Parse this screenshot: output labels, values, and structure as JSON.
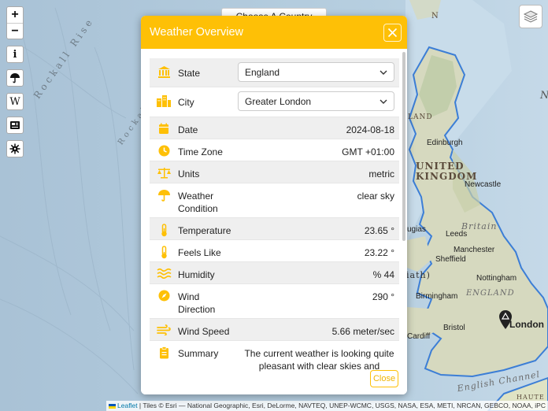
{
  "map": {
    "features": [
      "Rockall Rise",
      "Rockall"
    ],
    "regions": [
      "UNITED",
      "KINGDOM",
      "Britain",
      "ENGLAND",
      "English Channel",
      "HAUTE",
      "(IRELAND)"
    ],
    "partial_labels": [
      "LAND",
      "ugias",
      "iath)",
      "N",
      "N"
    ],
    "cities": [
      "Edinburgh",
      "Newcastle",
      "Leeds",
      "Manchester",
      "Sheffield",
      "Nottingham",
      "Birmingham",
      "Bristol",
      "Cardiff",
      "London"
    ],
    "country_select": "Choose A Country",
    "attribution": "Leaflet | Tiles © Esri — National Geographic, Esri, DeLorme, NAVTEQ, UNEP-WCMC, USGS, NASA, ESA, METI, NRCAN, GEBCO, NOAA, iPC",
    "attribution_link": "Leaflet",
    "attribution_rest": " | Tiles © Esri — National Geographic, Esri, DeLorme, NAVTEQ, UNEP-WCMC, USGS, NASA, ESA, METI, NRCAN, GEBCO, NOAA, iPC"
  },
  "controls": {
    "zoom_in": "+",
    "zoom_out": "−",
    "info": "i",
    "wiki": "W"
  },
  "modal": {
    "title": "Weather Overview",
    "close_button": "Close",
    "accent_color": "#fec006",
    "rows": [
      {
        "icon": "landmark-icon",
        "label": "State",
        "value": "England",
        "type": "select"
      },
      {
        "icon": "city-icon",
        "label": "City",
        "value": "Greater London",
        "type": "select"
      },
      {
        "icon": "calendar-icon",
        "label": "Date",
        "value": "2024-08-18"
      },
      {
        "icon": "clock-icon",
        "label": "Time Zone",
        "value": "GMT +01:00"
      },
      {
        "icon": "scale-icon",
        "label": "Units",
        "value": "metric"
      },
      {
        "icon": "umbrella-icon",
        "label": "Weather Condition",
        "value": "clear sky"
      },
      {
        "icon": "thermometer-icon",
        "label": "Temperature",
        "value": "23.65 °"
      },
      {
        "icon": "thermometer-icon",
        "label": "Feels Like",
        "value": "23.22 °"
      },
      {
        "icon": "water-icon",
        "label": "Humidity",
        "value": "% 44"
      },
      {
        "icon": "compass-icon",
        "label": "Wind Direction",
        "value": "290 °"
      },
      {
        "icon": "wind-icon",
        "label": "Wind Speed",
        "value": "5.66 meter/sec"
      },
      {
        "icon": "clipboard-icon",
        "label": "Summary",
        "value": "The current weather is looking quite pleasant with clear skies and"
      }
    ]
  }
}
